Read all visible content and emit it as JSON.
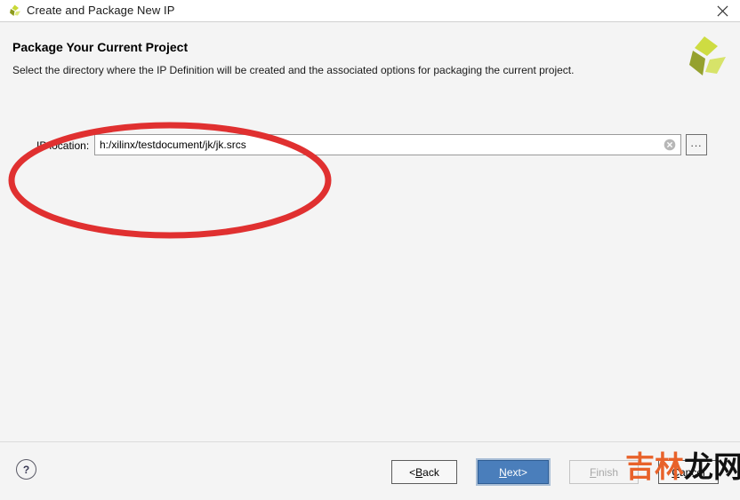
{
  "window": {
    "title": "Create and Package New IP",
    "icon": "xilinx-logo-icon",
    "close_label": "×"
  },
  "page": {
    "heading": "Package Your Current Project",
    "subtitle": "Select the directory where the IP Definition will be created and the associated options for packaging the current project.",
    "brand_logo": "xilinx-tri-blade-logo"
  },
  "form": {
    "ip_location": {
      "label": "IP location:",
      "value": "h:/xilinx/testdocument/jk/jk.srcs",
      "placeholder": "",
      "clear_icon": "clear-circle-icon",
      "browse_label": "..."
    }
  },
  "annotation": {
    "shape": "ellipse",
    "color": "#e03030",
    "target": "ip-location-field"
  },
  "footer": {
    "help_label": "?",
    "buttons": [
      {
        "name": "back",
        "prefix": "< ",
        "mnemonic": "B",
        "rest": "ack",
        "suffix": "",
        "state": "enabled"
      },
      {
        "name": "next",
        "prefix": "",
        "mnemonic": "N",
        "rest": "ext",
        "suffix": " >",
        "state": "default-focused"
      },
      {
        "name": "finish",
        "prefix": "",
        "mnemonic": "F",
        "rest": "inish",
        "suffix": "",
        "state": "disabled"
      },
      {
        "name": "cancel",
        "prefix": "",
        "mnemonic": "C",
        "rest": "ancel",
        "suffix": "",
        "state": "enabled"
      }
    ]
  },
  "watermark": {
    "part1": "吉林",
    "part2": "龙网",
    "color1": "#e8622a",
    "color2": "#111111"
  }
}
